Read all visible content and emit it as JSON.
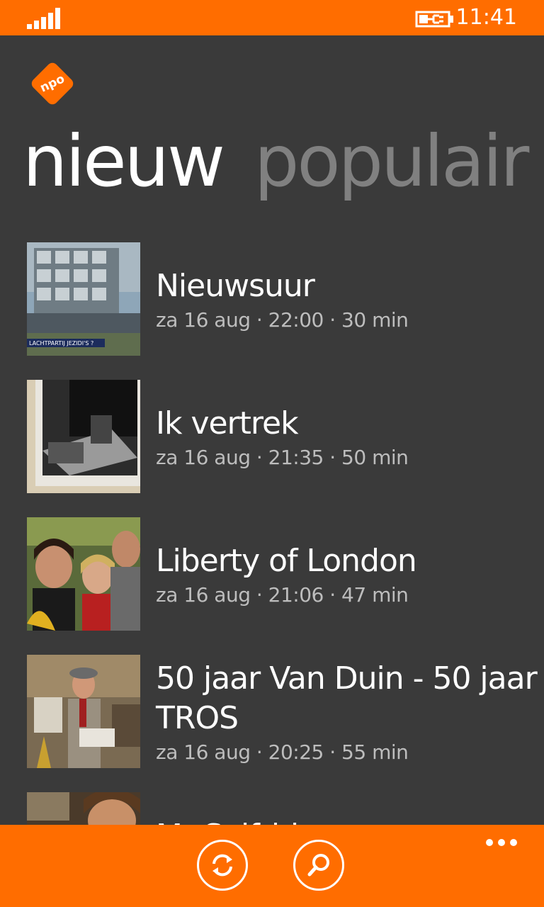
{
  "status_bar": {
    "time": "11:41",
    "signal_icon": "signal-strength-icon",
    "battery_icon": "battery-charging-icon",
    "background": "#ff6d00"
  },
  "app": {
    "logo_icon": "npo-logo-icon",
    "logo_text": "npo"
  },
  "pivot": {
    "active": "nieuw",
    "inactive": "populair"
  },
  "episodes": [
    {
      "title": "Nieuwsuur",
      "meta": "za 16 aug · 22:00 · 30 min",
      "thumb_caption": "LACHTPARTIJ JEZIDI'S ?"
    },
    {
      "title": "Ik vertrek",
      "meta": "za 16 aug · 21:35 · 50 min"
    },
    {
      "title": "Liberty of London",
      "meta": "za 16 aug · 21:06 · 47 min"
    },
    {
      "title": "50 jaar Van Duin - 50 jaar TROS",
      "meta": "za 16 aug · 20:25 · 55 min"
    },
    {
      "title": "Mr Selfridge",
      "meta": ""
    }
  ],
  "app_bar": {
    "refresh_icon": "refresh-icon",
    "search_icon": "search-icon",
    "more_icon": "more-dots-icon",
    "background": "#ff6d00"
  }
}
